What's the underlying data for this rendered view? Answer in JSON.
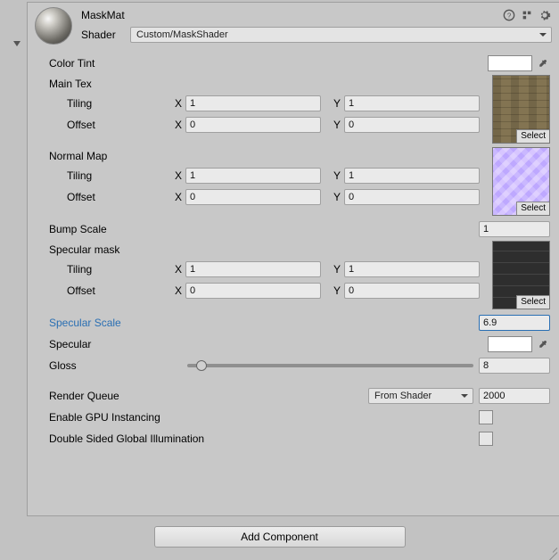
{
  "material": {
    "name": "MaskMat"
  },
  "shader": {
    "label": "Shader",
    "value": "Custom/MaskShader"
  },
  "colorTint": {
    "label": "Color Tint",
    "hex": "#ffffff"
  },
  "mainTex": {
    "label": "Main Tex",
    "tilingLabel": "Tiling",
    "offsetLabel": "Offset",
    "tiling": {
      "x": "1",
      "y": "1"
    },
    "offset": {
      "x": "0",
      "y": "0"
    },
    "selectLabel": "Select"
  },
  "normalMap": {
    "label": "Normal Map",
    "tilingLabel": "Tiling",
    "offsetLabel": "Offset",
    "tiling": {
      "x": "1",
      "y": "1"
    },
    "offset": {
      "x": "0",
      "y": "0"
    },
    "selectLabel": "Select"
  },
  "bumpScale": {
    "label": "Bump Scale",
    "value": "1"
  },
  "specMask": {
    "label": "Specular mask",
    "tilingLabel": "Tiling",
    "offsetLabel": "Offset",
    "tiling": {
      "x": "1",
      "y": "1"
    },
    "offset": {
      "x": "0",
      "y": "0"
    },
    "selectLabel": "Select"
  },
  "specScale": {
    "label": "Specular Scale",
    "value": "6.9"
  },
  "specularColor": {
    "label": "Specular",
    "hex": "#ffffff"
  },
  "gloss": {
    "label": "Gloss",
    "value": "8",
    "min": 0,
    "max": 256
  },
  "renderQueue": {
    "label": "Render Queue",
    "mode": "From Shader",
    "value": "2000"
  },
  "gpuInstancing": {
    "label": "Enable GPU Instancing",
    "checked": false
  },
  "doubleSidedGI": {
    "label": "Double Sided Global Illumination",
    "checked": false
  },
  "addComponent": "Add Component",
  "axis": {
    "x": "X",
    "y": "Y"
  }
}
